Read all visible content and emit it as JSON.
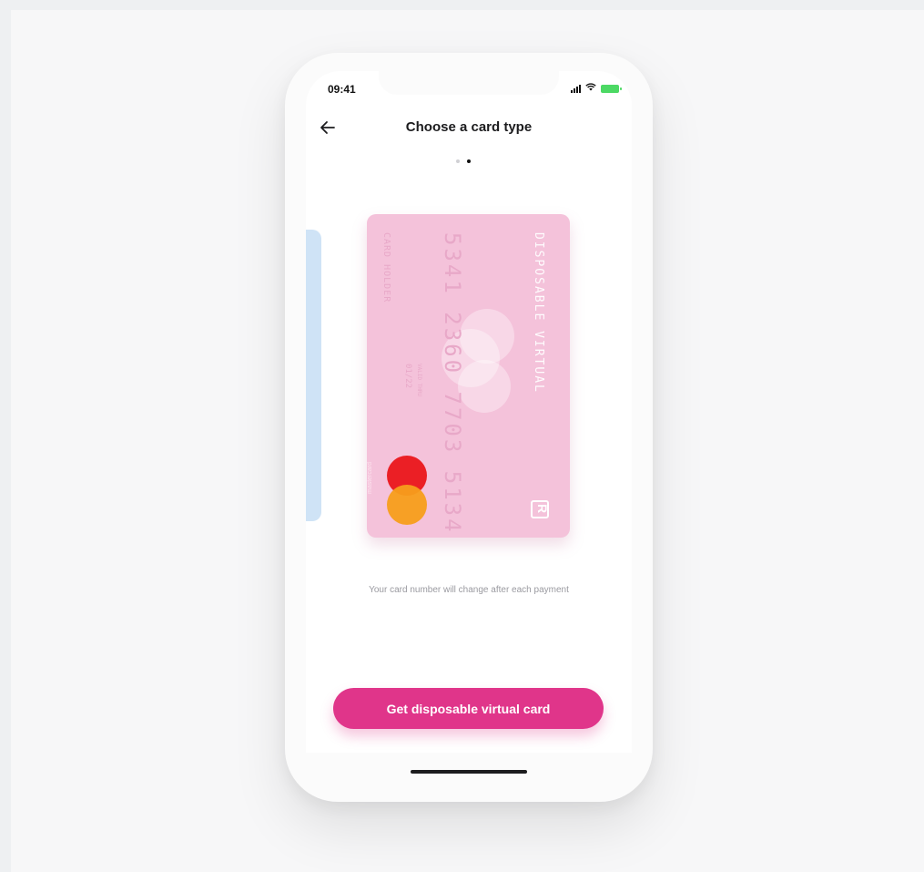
{
  "status_bar": {
    "time": "09:41",
    "battery_color": "#4cd964"
  },
  "header": {
    "title": "Choose a card type",
    "back_icon": "arrow-left-icon"
  },
  "pager": {
    "total": 2,
    "active_index": 1
  },
  "card": {
    "type_label": "DISPOSABLE VIRTUAL",
    "number": "5341 2360 7703 5134",
    "holder": "CARD HOLDER",
    "expiry_label": "VALID THRU",
    "expiry": "01/22",
    "network": "mastercard",
    "background_color": "#f4c2da",
    "brand_icon": "revolut-logo-icon"
  },
  "caption": "Your card number will change after each payment",
  "cta": {
    "label": "Get disposable virtual card",
    "color": "#e0358a"
  }
}
